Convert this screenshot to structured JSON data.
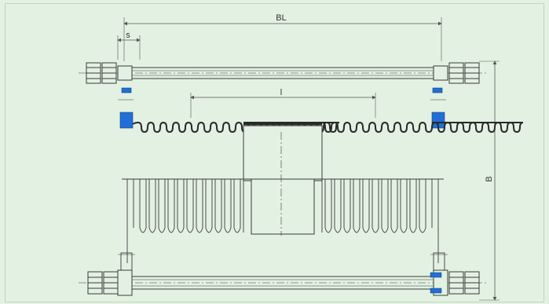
{
  "diagram": {
    "labels": {
      "overall_length": "BL",
      "spacing": "s",
      "bellows_length": "l",
      "height": "B"
    },
    "colors": {
      "background": "#e3f1e2",
      "line": "#3a3a3a",
      "seal": "#1f6fd6",
      "dimension": "#555555"
    },
    "components": [
      "tie-rod-assembly",
      "nut-pair",
      "gasket",
      "bellows-left",
      "bellows-right",
      "center-pipe",
      "elevation-bellows",
      "elevation-tie-rod"
    ]
  }
}
